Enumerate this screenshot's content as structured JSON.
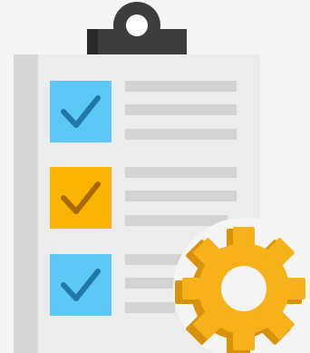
{
  "illustration": {
    "icon": "clipboard-checklist-with-gear-icon",
    "colors": {
      "background": "#f5f5f5",
      "board": "#ececec",
      "board_shadow_strip": "#d7d7d7",
      "clip": "#3d3d3d",
      "clip_shade": "#2a2a2a",
      "text_line": "#d3d3d3",
      "check_blue": "#5bc8f5",
      "check_blue_mark": "#1f78a8",
      "check_orange": "#f8b400",
      "check_orange_mark": "#a86a00",
      "gear": "#f7b21a",
      "gear_shade": "#d8920b"
    }
  },
  "checklist": {
    "items": [
      {
        "state": "checked",
        "color": "blue"
      },
      {
        "state": "checked",
        "color": "orange"
      },
      {
        "state": "checked",
        "color": "blue"
      }
    ]
  }
}
